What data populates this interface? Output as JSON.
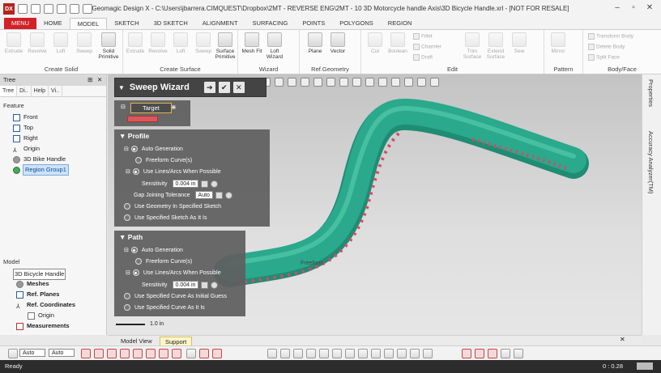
{
  "window": {
    "title": "Geomagic Design X - C:\\Users\\jbarrera.CIMQUEST\\Dropbox\\2MT - REVERSE ENG\\2MT - 10 3D Motorcycle handle Axis\\3D Bicycle Handle.xrl - [NOT FOR RESALE]",
    "app_logo": "DX"
  },
  "menu_tabs": [
    "MENU",
    "HOME",
    "MODEL",
    "SKETCH",
    "3D SKETCH",
    "ALIGNMENT",
    "SURFACING",
    "POINTS",
    "POLYGONS",
    "REGION"
  ],
  "ribbon": {
    "create_solid": {
      "title": "Create Solid",
      "buttons": [
        "Extrude",
        "Revolve",
        "Loft",
        "Sweep",
        "Solid Primitive"
      ]
    },
    "create_surface": {
      "title": "Create Surface",
      "buttons": [
        "Extrude",
        "Revolve",
        "Loft",
        "Sweep",
        "Surface Primitive"
      ]
    },
    "wizard": {
      "title": "Wizard",
      "buttons": [
        "Mesh Fit",
        "Loft Wizard"
      ]
    },
    "ref_geometry": {
      "title": "Ref.Geometry",
      "buttons": [
        "Plane",
        "Vector"
      ]
    },
    "edit": {
      "title": "Edit",
      "buttons": [
        "Cut",
        "Boolean",
        "Trim Surface",
        "Extend Surface",
        "Sew"
      ],
      "small": [
        "Fillet",
        "Chamfer",
        "Draft"
      ]
    },
    "pattern": {
      "title": "Pattern",
      "buttons": [
        "Mirror"
      ]
    },
    "body_face": {
      "title": "Body/Face",
      "small": [
        "Transform Body",
        "Delete Body",
        "Split Face"
      ]
    }
  },
  "tree_panel": {
    "title": "Tree",
    "tabs": [
      "Tree",
      "Di..",
      "Help",
      "Vi.."
    ],
    "feature_label": "Feature",
    "features": [
      "Front",
      "Top",
      "Right",
      "Origin",
      "3D Bike Handle",
      "Region Group1"
    ],
    "model_label": "Model",
    "model_items": [
      "3D Bicycle Handle",
      "Meshes",
      "Ref. Planes",
      "Ref. Coordinates",
      "Origin",
      "Measurements"
    ]
  },
  "sweep_wizard": {
    "title": "Sweep Wizard",
    "target_label": "Target",
    "profile": {
      "header": "Profile",
      "auto_generation": "Auto Generation",
      "freeform": "Freeform Curve(s)",
      "lines_arcs": "Use Lines/Arcs When Possible",
      "sensitivity_label": "Sensitivity",
      "sensitivity_value": "0.004 in",
      "gap_label": "Gap Joining Tolerance",
      "gap_value": "Auto",
      "use_geometry": "Use Geometry In Specified Sketch",
      "use_sketch": "Use Specified Sketch As It Is"
    },
    "path": {
      "header": "Path",
      "auto_generation": "Auto Generation",
      "freeform": "Freeform Curve(s)",
      "lines_arcs": "Use Lines/Arcs When Possible",
      "sensitivity_label": "Sensitivity",
      "sensitivity_value": "0.004 in",
      "initial_guess": "Use Specified Curve As Initial Guess",
      "use_curve": "Use Specified Curve As It Is"
    }
  },
  "viewport": {
    "freeform_label": "Freeform",
    "scale_label": "1.0 in"
  },
  "right_bar": {
    "properties": "Properties",
    "accuracy": "Accuracy Analyzer(TM)"
  },
  "bottom_tabs": [
    "Model View",
    "Support"
  ],
  "bottom_toolbar": {
    "select_mode_1": "Auto",
    "select_mode_2": "Auto"
  },
  "status": {
    "left": "Ready",
    "time": "0 : 0.28"
  },
  "colors": {
    "accent": "#d32128",
    "model_surface": "#2aa98c",
    "deviation": "#d64a63"
  }
}
